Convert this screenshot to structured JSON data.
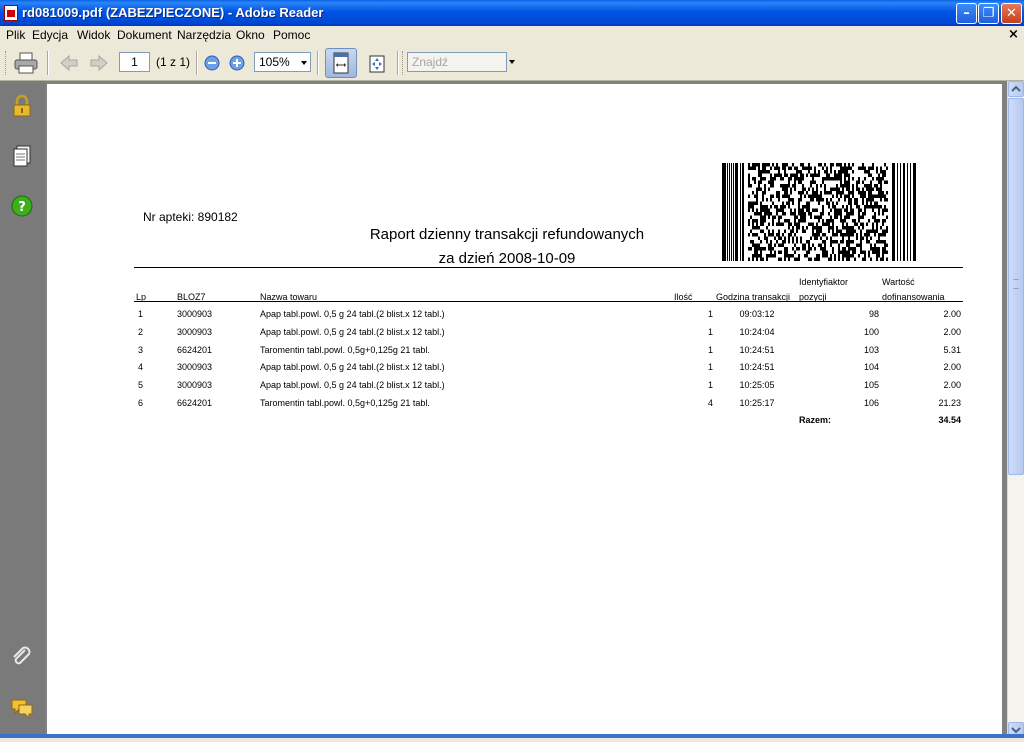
{
  "window": {
    "title": "rd081009.pdf (ZABEZPIECZONE) - Adobe Reader",
    "minimize_glyph": "–",
    "maximize_glyph": "❐",
    "close_glyph": "✕"
  },
  "menu": {
    "items": [
      {
        "label": "Plik"
      },
      {
        "label": "Edycja"
      },
      {
        "label": "Widok"
      },
      {
        "label": "Dokument"
      },
      {
        "label": "Narzędzia"
      },
      {
        "label": "Okno"
      },
      {
        "label": "Pomoc"
      }
    ],
    "close_glyph": "×"
  },
  "toolbar": {
    "page_number": "1",
    "page_count": "(1 z 1)",
    "zoom": "105%",
    "find_placeholder": "Znajdź"
  },
  "sidebar": {
    "icons": [
      "lock-icon",
      "pages-icon",
      "help-icon",
      "attachment-icon",
      "comments-icon"
    ]
  },
  "report": {
    "pharmacy_number": "Nr apteki: 890182",
    "title_line1": "Raport dzienny transakcji refundowanych",
    "title_line2": "za dzień 2008-10-09",
    "headers": {
      "lp": "Lp",
      "bloz": "BLOZ7",
      "name": "Nazwa towaru",
      "qty": "Ilość",
      "time": "Godzina transakcji",
      "id_line1": "Identyfiaktor",
      "id_line2": "pozycji",
      "value_line1": "Wartość",
      "value_line2": "dofinansowania"
    },
    "rows": [
      {
        "lp": "1",
        "bloz": "3000903",
        "name": "Apap tabl.powl. 0,5 g 24 tabl.(2 blist.x 12 tabl.)",
        "qty": "1",
        "time": "09:03:12",
        "id": "98",
        "value": "2.00"
      },
      {
        "lp": "2",
        "bloz": "3000903",
        "name": "Apap tabl.powl. 0,5 g 24 tabl.(2 blist.x 12 tabl.)",
        "qty": "1",
        "time": "10:24:04",
        "id": "100",
        "value": "2.00"
      },
      {
        "lp": "3",
        "bloz": "6624201",
        "name": "Taromentin tabl.powl. 0,5g+0,125g 21 tabl.",
        "qty": "1",
        "time": "10:24:51",
        "id": "103",
        "value": "5.31"
      },
      {
        "lp": "4",
        "bloz": "3000903",
        "name": "Apap tabl.powl. 0,5 g 24 tabl.(2 blist.x 12 tabl.)",
        "qty": "1",
        "time": "10:24:51",
        "id": "104",
        "value": "2.00"
      },
      {
        "lp": "5",
        "bloz": "3000903",
        "name": "Apap tabl.powl. 0,5 g 24 tabl.(2 blist.x 12 tabl.)",
        "qty": "1",
        "time": "10:25:05",
        "id": "105",
        "value": "2.00"
      },
      {
        "lp": "6",
        "bloz": "6624201",
        "name": "Taromentin tabl.powl. 0,5g+0,125g 21 tabl.",
        "qty": "4",
        "time": "10:25:17",
        "id": "106",
        "value": "21.23"
      }
    ],
    "total_label": "Razem:",
    "total_value": "34.54"
  }
}
